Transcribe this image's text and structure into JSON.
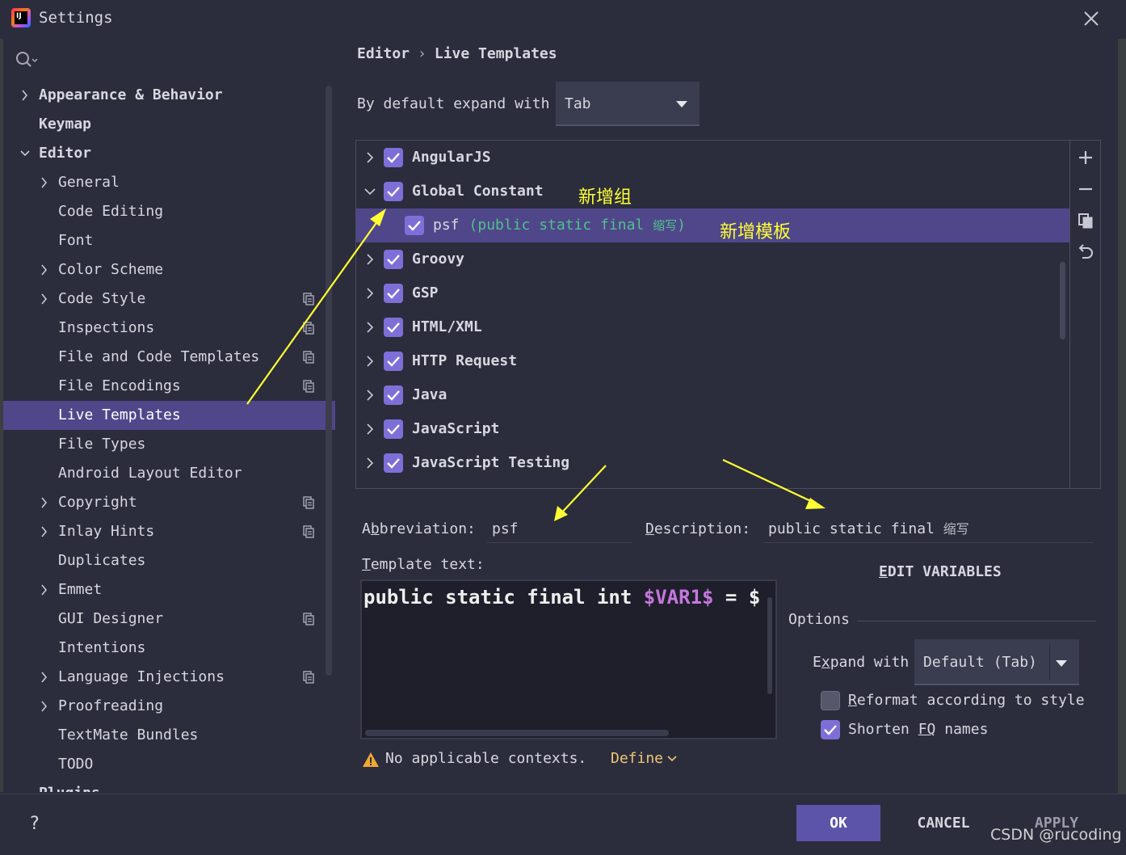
{
  "window": {
    "title": "Settings"
  },
  "sidebar": {
    "items": [
      {
        "label": "Appearance & Behavior",
        "level": 0,
        "expandable": true,
        "expanded": false,
        "bold": true
      },
      {
        "label": "Keymap",
        "level": 0,
        "expandable": false,
        "bold": true
      },
      {
        "label": "Editor",
        "level": 0,
        "expandable": true,
        "expanded": true,
        "bold": true
      },
      {
        "label": "General",
        "level": 1,
        "expandable": true,
        "expanded": false
      },
      {
        "label": "Code Editing",
        "level": 1,
        "expandable": false
      },
      {
        "label": "Font",
        "level": 1,
        "expandable": false
      },
      {
        "label": "Color Scheme",
        "level": 1,
        "expandable": true,
        "expanded": false
      },
      {
        "label": "Code Style",
        "level": 1,
        "expandable": true,
        "expanded": false,
        "project_icon": true
      },
      {
        "label": "Inspections",
        "level": 1,
        "expandable": false,
        "project_icon": true
      },
      {
        "label": "File and Code Templates",
        "level": 1,
        "expandable": false,
        "project_icon": true
      },
      {
        "label": "File Encodings",
        "level": 1,
        "expandable": false,
        "project_icon": true
      },
      {
        "label": "Live Templates",
        "level": 1,
        "expandable": false,
        "selected": true
      },
      {
        "label": "File Types",
        "level": 1,
        "expandable": false
      },
      {
        "label": "Android Layout Editor",
        "level": 1,
        "expandable": false
      },
      {
        "label": "Copyright",
        "level": 1,
        "expandable": true,
        "expanded": false,
        "project_icon": true
      },
      {
        "label": "Inlay Hints",
        "level": 1,
        "expandable": true,
        "expanded": false,
        "project_icon": true
      },
      {
        "label": "Duplicates",
        "level": 1,
        "expandable": false
      },
      {
        "label": "Emmet",
        "level": 1,
        "expandable": true,
        "expanded": false
      },
      {
        "label": "GUI Designer",
        "level": 1,
        "expandable": false,
        "project_icon": true
      },
      {
        "label": "Intentions",
        "level": 1,
        "expandable": false
      },
      {
        "label": "Language Injections",
        "level": 1,
        "expandable": true,
        "expanded": false,
        "project_icon": true
      },
      {
        "label": "Proofreading",
        "level": 1,
        "expandable": true,
        "expanded": false
      },
      {
        "label": "TextMate Bundles",
        "level": 1,
        "expandable": false
      },
      {
        "label": "TODO",
        "level": 1,
        "expandable": false
      },
      {
        "label": "Plugins",
        "level": 0,
        "expandable": false,
        "bold": true
      }
    ]
  },
  "breadcrumb": {
    "parent": "Editor",
    "separator": "›",
    "current": "Live Templates"
  },
  "expand_default": {
    "label": "By default expand with",
    "value": "Tab"
  },
  "templates": [
    {
      "name": "AngularJS",
      "checked": true,
      "expanded": false,
      "child": false
    },
    {
      "name": "Global Constant",
      "checked": true,
      "expanded": true,
      "child": false
    },
    {
      "name": "psf",
      "description": "(public static final ",
      "description_cn": "缩写",
      "description_end": ")",
      "checked": true,
      "child": true,
      "selected": true
    },
    {
      "name": "Groovy",
      "checked": true,
      "expanded": false,
      "child": false
    },
    {
      "name": "GSP",
      "checked": true,
      "expanded": false,
      "child": false
    },
    {
      "name": "HTML/XML",
      "checked": true,
      "expanded": false,
      "child": false
    },
    {
      "name": "HTTP Request",
      "checked": true,
      "expanded": false,
      "child": false
    },
    {
      "name": "Java",
      "checked": true,
      "expanded": false,
      "child": false
    },
    {
      "name": "JavaScript",
      "checked": true,
      "expanded": false,
      "child": false
    },
    {
      "name": "JavaScript Testing",
      "checked": true,
      "expanded": false,
      "child": false
    }
  ],
  "annotations": {
    "new_group": "新增组",
    "new_template": "新增模板"
  },
  "abbreviation": {
    "label_pre": "A",
    "label_u": "b",
    "label_post": "breviation:",
    "value": "psf"
  },
  "description": {
    "label_u": "D",
    "label_post": "escription:",
    "value": "public static final ",
    "value_cn": "缩写"
  },
  "template_text": {
    "label_u": "T",
    "label_post": "emplate text:",
    "code_plain": "public static final int ",
    "code_var": "$VAR1$",
    "code_rest": " = $"
  },
  "edit_variables": {
    "label_u": "E",
    "label_post": "DIT VARIABLES"
  },
  "options": {
    "title": "Options",
    "expand_with_label_pre": "E",
    "expand_with_label_u": "x",
    "expand_with_label_post": "pand with",
    "expand_with_value": "Default (Tab)",
    "reformat_label_u": "R",
    "reformat_label_post": "eformat according to style",
    "reformat_checked": false,
    "shorten_label_pre": "Shorten ",
    "shorten_label_u": "FQ",
    "shorten_label_post": " names",
    "shorten_checked": true
  },
  "context": {
    "warning": "No applicable contexts.",
    "define": "Define"
  },
  "footer": {
    "help": "?",
    "ok": "OK",
    "cancel": "CANCEL",
    "apply": "APPLY"
  },
  "watermark": "CSDN @rucoding",
  "colors": {
    "accent": "#7e6fd8",
    "selection": "#4f4789",
    "annotation": "#ffff33"
  }
}
